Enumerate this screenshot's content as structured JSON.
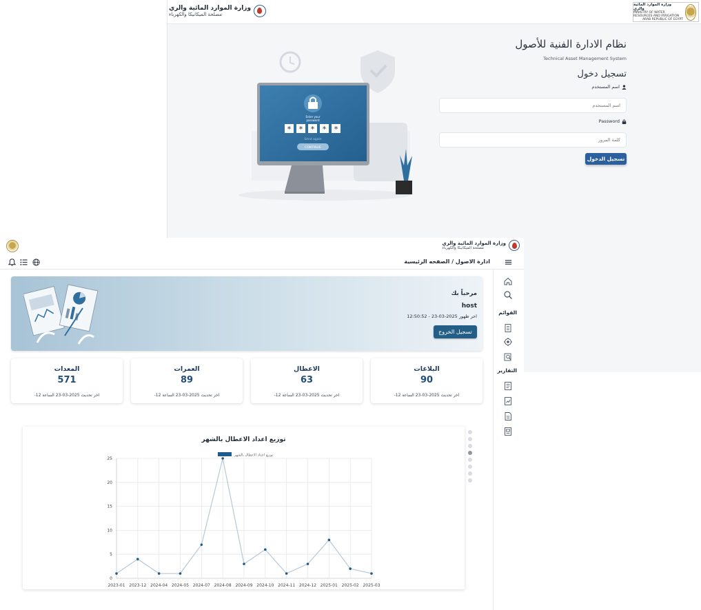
{
  "login": {
    "org_name_line1": "وزارة الموارد المائية والري",
    "org_name_line2": "مصلحة الميكانيكا والكهرباء",
    "ministry_line1": "وزارة الموارد المائية والري",
    "ministry_line2": "MINISTRY OF WATER RESOURCES AND IRRIGATION",
    "ministry_line3": "ARAB REPUBLIC OF EGYPT",
    "title": "نظام الادارة الفنية للأصول",
    "subtitle": "Technical Asset Management System",
    "login_heading": "تسجيل دخول",
    "username_label": "اسم المستخدم",
    "username_placeholder": "اسم المستخدم",
    "password_label": "Password",
    "password_placeholder": "كلمة المرور",
    "submit_label": "تسجيل الدخول",
    "illustration": {
      "prompt_line1": "Enter your",
      "prompt_line2": "password",
      "masked": [
        "*",
        "*",
        "*",
        "*",
        "*"
      ],
      "send_again": "Send again",
      "continue_label": "CONTINUE"
    }
  },
  "dashboard": {
    "org_name_line1": "وزارة الموارد المائية والري",
    "org_name_line2": "مصلحة الميكانيكا والكهرباء",
    "breadcrumb": "ادارة الاصول / الصفحه الرئيسية",
    "sidebar": {
      "lists_heading": "القوائم",
      "reports_heading": "التقارير"
    },
    "welcome": {
      "title": "مرحباً بك",
      "username": "host",
      "last_seen": "اخر ظهور 2025-03-23 - 12:50:52",
      "logout_label": "تسجيل الخروج"
    },
    "stats": [
      {
        "title": "البلاغات",
        "value": "90",
        "updated": "اخر تحديث 2025-03-23 الساعة 12-"
      },
      {
        "title": "الاعطال",
        "value": "63",
        "updated": "اخر تحديث 2025-03-23 الساعة 12-"
      },
      {
        "title": "العمرات",
        "value": "89",
        "updated": "اخر تحديث 2025-03-23 الساعة 12-"
      },
      {
        "title": "المعدات",
        "value": "571",
        "updated": "اخر تحديث 2025-03-23 الساعة 12-"
      }
    ],
    "pager_dots": 8,
    "pager_active_index": 3
  },
  "colors": {
    "primary": "#2c5f9e",
    "dark_blue": "#1f4e79",
    "chart_line": "#b9c7d4",
    "chart_point": "#1f5c8b"
  },
  "chart_data": {
    "type": "line",
    "title": "توزيع اعداد الاعطال بالشهر",
    "legend": "توزيع اعداد الاعطال بالشهر",
    "legend_position": "top",
    "x": [
      "2023-01",
      "2023-12",
      "2024-04",
      "2024-05",
      "2024-07",
      "2024-08",
      "2024-09",
      "2024-10",
      "2024-11",
      "2024-12",
      "2025-01",
      "2025-02",
      "2025-03"
    ],
    "y": [
      1,
      4,
      1,
      1,
      7,
      25,
      3,
      6,
      1,
      3,
      8,
      2,
      1
    ],
    "ylim": [
      0,
      25
    ],
    "yticks": [
      0,
      5,
      10,
      15,
      20,
      25
    ],
    "grid": true
  }
}
